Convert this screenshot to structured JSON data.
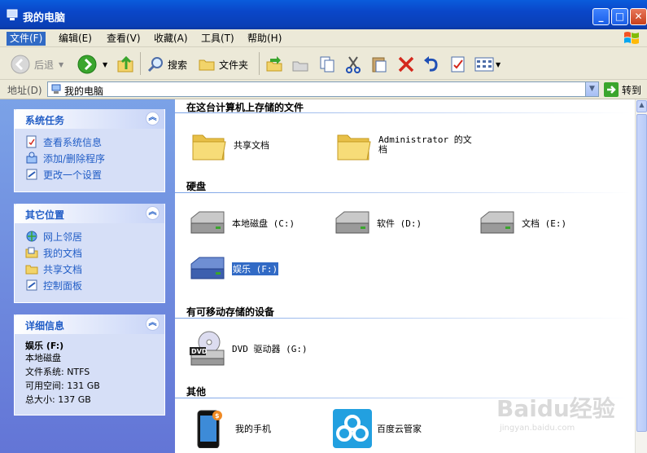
{
  "window": {
    "title": "我的电脑"
  },
  "menu": [
    "文件(F)",
    "编辑(E)",
    "查看(V)",
    "收藏(A)",
    "工具(T)",
    "帮助(H)"
  ],
  "toolbar": {
    "back": "后退",
    "search": "搜索",
    "folders": "文件夹"
  },
  "address": {
    "label": "地址(D)",
    "value": "我的电脑",
    "go": "转到"
  },
  "panels": {
    "system_tasks": {
      "title": "系统任务",
      "items": [
        "查看系统信息",
        "添加/删除程序",
        "更改一个设置"
      ]
    },
    "other_places": {
      "title": "其它位置",
      "items": [
        "网上邻居",
        "我的文档",
        "共享文档",
        "控制面板"
      ]
    },
    "details": {
      "title": "详细信息",
      "name": "娱乐 (F:)",
      "type": "本地磁盘",
      "fs": "文件系统: NTFS",
      "free": "可用空间: 131 GB",
      "total": "总大小: 137 GB"
    }
  },
  "sections": {
    "stored": {
      "title": "在这台计算机上存储的文件",
      "items": [
        "共享文档",
        "Administrator 的文档"
      ]
    },
    "hdd": {
      "title": "硬盘",
      "items": [
        "本地磁盘 (C:)",
        "软件 (D:)",
        "文档 (E:)",
        "娱乐 (F:)"
      ]
    },
    "removable": {
      "title": "有可移动存储的设备",
      "items": [
        "DVD 驱动器 (G:)"
      ]
    },
    "other": {
      "title": "其他",
      "items": [
        "我的手机",
        "百度云管家"
      ]
    }
  },
  "watermark": "Baidu经验",
  "watermark_url": "jingyan.baidu.com"
}
